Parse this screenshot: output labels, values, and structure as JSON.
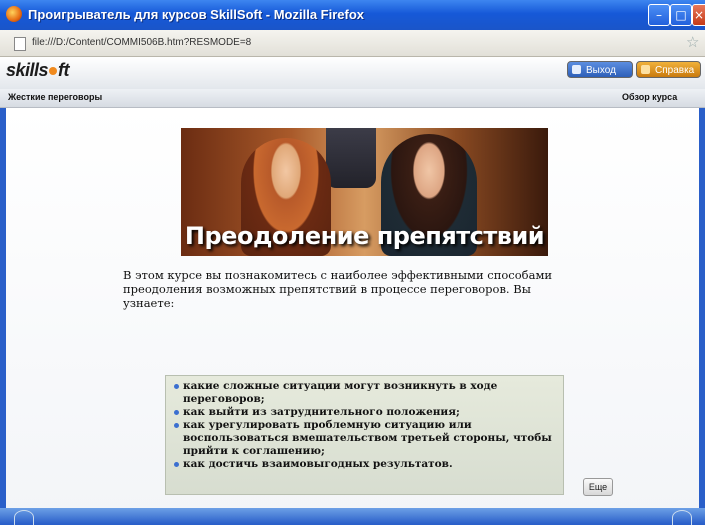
{
  "browser": {
    "title": "Проигрыватель для курсов SkillSoft - Mozilla Firefox",
    "url": "file:///D:/Content/COMMI506B.htm?RESMODE=8"
  },
  "app": {
    "logo": {
      "part1": "skills",
      "part2": "ft"
    },
    "exit_label": "Выход",
    "help_label": "Справка",
    "course_name": "Жесткие переговоры",
    "section_label": "Обзор курса"
  },
  "content": {
    "banner_title": "Преодоление препятствий",
    "intro": "В этом курсе вы познакомитесь с наиболее эффективными способами преодоления возможных препятствий в процессе переговоров. Вы узнаете:",
    "points": [
      "какие сложные ситуации могут возникнуть в ходе переговоров;",
      "как выйти из затруднительного положения;",
      "как урегулировать проблемную ситуацию или воспользоваться вмешательством третьей стороны, чтобы прийти к соглашению;",
      "как достичь взаимовыгодных результатов."
    ],
    "more_label": "Еще"
  }
}
